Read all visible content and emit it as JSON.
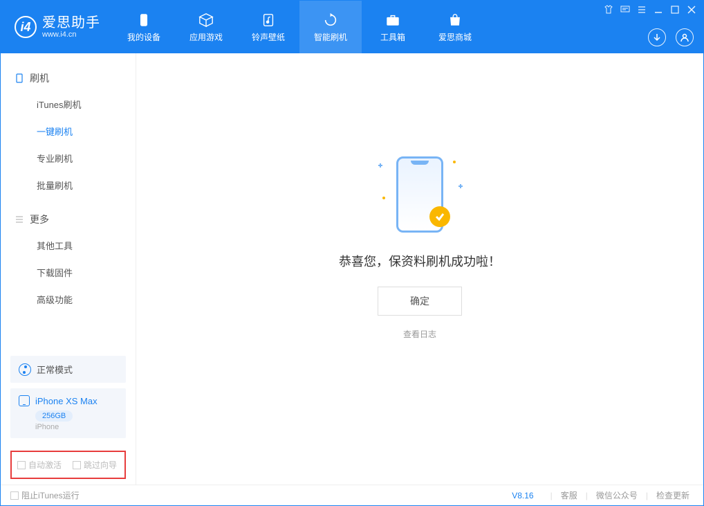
{
  "logo": {
    "name": "爱思助手",
    "url": "www.i4.cn"
  },
  "nav": {
    "items": [
      {
        "label": "我的设备"
      },
      {
        "label": "应用游戏"
      },
      {
        "label": "铃声壁纸"
      },
      {
        "label": "智能刷机",
        "active": true
      },
      {
        "label": "工具箱"
      },
      {
        "label": "爱思商城"
      }
    ]
  },
  "sidebar": {
    "group1": {
      "title": "刷机",
      "items": [
        {
          "label": "iTunes刷机"
        },
        {
          "label": "一键刷机",
          "active": true
        },
        {
          "label": "专业刷机"
        },
        {
          "label": "批量刷机"
        }
      ]
    },
    "group2": {
      "title": "更多",
      "items": [
        {
          "label": "其他工具"
        },
        {
          "label": "下载固件"
        },
        {
          "label": "高级功能"
        }
      ]
    },
    "mode": {
      "label": "正常模式"
    },
    "device": {
      "name": "iPhone XS Max",
      "storage": "256GB",
      "type": "iPhone"
    },
    "checkboxes": {
      "auto_activate": "自动激活",
      "skip_guide": "跳过向导"
    }
  },
  "main": {
    "success_text": "恭喜您，保资料刷机成功啦！",
    "ok_button": "确定",
    "log_link": "查看日志"
  },
  "footer": {
    "block_itunes": "阻止iTunes运行",
    "version": "V8.16",
    "links": {
      "service": "客服",
      "wechat": "微信公众号",
      "update": "检查更新"
    }
  }
}
